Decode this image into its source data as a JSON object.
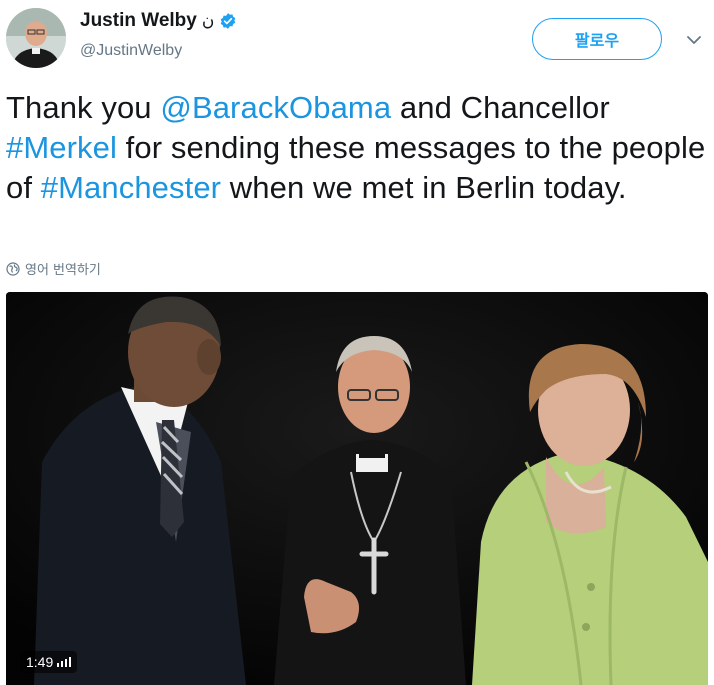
{
  "header": {
    "display_name": "Justin Welby",
    "name_suffix": "ن",
    "handle": "@JustinWelby",
    "follow_label": "팔로우",
    "avatar_icon": "user-avatar-photo",
    "verified_icon": "verified-badge-icon",
    "caret_icon": "chevron-down-icon"
  },
  "tweet": {
    "segments": [
      {
        "text": "Thank you ",
        "link": false
      },
      {
        "text": "@BarackObama",
        "link": true
      },
      {
        "text": " and Chancellor ",
        "link": false
      },
      {
        "text": "#Merkel",
        "link": true
      },
      {
        "text": " for sending these messages to the people of ",
        "link": false
      },
      {
        "text": "#Manchester",
        "link": true
      },
      {
        "text": " when we met in Berlin today.",
        "link": false
      }
    ],
    "translate_label": "영어 번역하기"
  },
  "video": {
    "duration": "1:49",
    "volume_icon": "volume-bars-icon"
  },
  "colors": {
    "link": "#1b95e0",
    "accent": "#1da1f2",
    "secondary_text": "#657786",
    "merkel_jacket": "#b5cf7a"
  }
}
